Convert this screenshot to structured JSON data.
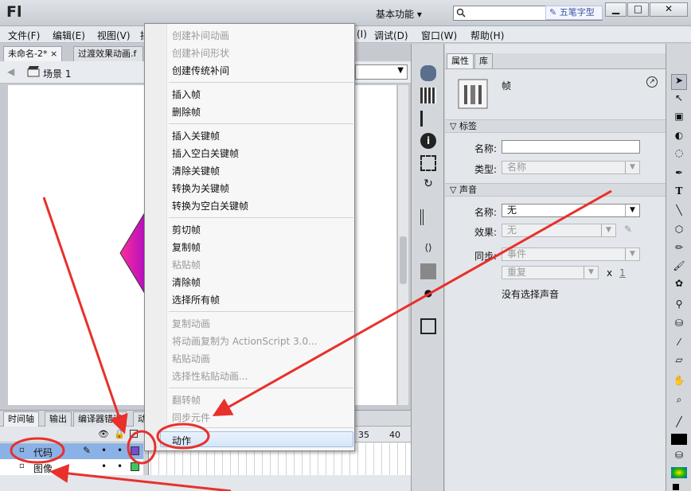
{
  "app": {
    "logo": "Fl",
    "workspace": "基本功能",
    "workspace_arrow": "▾",
    "search_placeholder": "",
    "watermark": "五笔字型"
  },
  "window_buttons": {
    "minimize": "▁",
    "maximize": "□",
    "close": "✕"
  },
  "menubar": [
    "文件(F)",
    "编辑(E)",
    "视图(V)",
    "插",
    "(I)",
    "调试(D)",
    "窗口(W)",
    "帮助(H)"
  ],
  "doc_tabs": [
    "未命名-2*",
    "过渡效果动画.f"
  ],
  "doc_tab_close": "×",
  "scene": {
    "label": "场景 1"
  },
  "timeline": {
    "tabs": [
      "时间轴",
      "输出",
      "编译器错误",
      "动"
    ],
    "frame_numbers": [
      "35",
      "40"
    ],
    "layers": [
      {
        "name": "代码",
        "selected": true
      },
      {
        "name": "图像",
        "selected": false
      }
    ]
  },
  "context_menu": {
    "groups": [
      [
        {
          "label": "创建补间动画",
          "enabled": false
        },
        {
          "label": "创建补间形状",
          "enabled": false
        },
        {
          "label": "创建传统补间",
          "enabled": true
        }
      ],
      [
        {
          "label": "插入帧",
          "enabled": true
        },
        {
          "label": "删除帧",
          "enabled": true
        }
      ],
      [
        {
          "label": "插入关键帧",
          "enabled": true
        },
        {
          "label": "插入空白关键帧",
          "enabled": true
        },
        {
          "label": "清除关键帧",
          "enabled": true
        },
        {
          "label": "转换为关键帧",
          "enabled": true
        },
        {
          "label": "转换为空白关键帧",
          "enabled": true
        }
      ],
      [
        {
          "label": "剪切帧",
          "enabled": true
        },
        {
          "label": "复制帧",
          "enabled": true
        },
        {
          "label": "粘贴帧",
          "enabled": false
        },
        {
          "label": "清除帧",
          "enabled": true
        },
        {
          "label": "选择所有帧",
          "enabled": true
        }
      ],
      [
        {
          "label": "复制动画",
          "enabled": false
        },
        {
          "label": "将动画复制为 ActionScript 3.0...",
          "enabled": false
        },
        {
          "label": "粘贴动画",
          "enabled": false
        },
        {
          "label": "选择性粘贴动画...",
          "enabled": false
        }
      ],
      [
        {
          "label": "翻转帧",
          "enabled": false
        },
        {
          "label": "同步元件",
          "enabled": false
        }
      ],
      [
        {
          "label": "动作",
          "enabled": true,
          "highlighted": true
        }
      ]
    ]
  },
  "properties": {
    "tabs": [
      "属性",
      "库"
    ],
    "object_type": "帧",
    "section_label": "标签",
    "name_label": "名称:",
    "name_value": "",
    "type_label": "类型:",
    "type_value": "名称",
    "section_sound": "声音",
    "sound_name_label": "名称:",
    "sound_name_value": "无",
    "effect_label": "效果:",
    "effect_value": "无",
    "sync_label": "同步:",
    "sync_value": "事件",
    "repeat_value": "重复",
    "repeat_x": "x",
    "repeat_count": "1",
    "no_sound": "没有选择声音"
  },
  "colors": {
    "accent_arrow": "#e8302c",
    "highlight_circle": "#e8302c",
    "selected_layer": "#8bb2e6",
    "stage_shape": "#d41aa8"
  }
}
